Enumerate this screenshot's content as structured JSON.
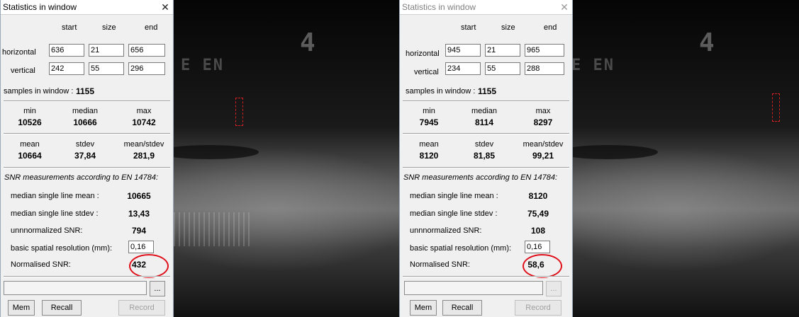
{
  "panels": [
    {
      "title": "Statistics in window",
      "close_glyph": "✕",
      "col_start": "start",
      "col_size": "size",
      "col_end": "end",
      "horizontal_label": "horizontal",
      "vertical_label": "vertical",
      "h_start": "636",
      "h_size": "21",
      "h_end": "656",
      "v_start": "242",
      "v_size": "55",
      "v_end": "296",
      "samples_label": "samples in window :",
      "samples_value": "1155",
      "min_label": "min",
      "median_label": "median",
      "max_label": "max",
      "min": "10526",
      "median": "10666",
      "max": "10742",
      "mean_label": "mean",
      "stdev_label": "stdev",
      "ratio_label": "mean/stdev",
      "mean": "10664",
      "stdev": "37,84",
      "ratio": "281,9",
      "snr_heading": "SNR measurements according to EN 14784:",
      "msl_mean_label": "median single line mean :",
      "msl_mean": "10665",
      "msl_stdev_label": "median single line stdev :",
      "msl_stdev": "13,43",
      "unnorm_label": "unnnormalized SNR:",
      "unnorm": "794",
      "bsr_label": "basic spatial resolution (mm):",
      "bsr": "0,16",
      "norm_label": "Normalised SNR:",
      "norm": "432",
      "browse_label": "...",
      "mem_label": "Mem",
      "recall_label": "Recall",
      "record_label": "Record"
    },
    {
      "title": "Statistics in window",
      "close_glyph": "✕",
      "col_start": "start",
      "col_size": "size",
      "col_end": "end",
      "horizontal_label": "horizontal",
      "vertical_label": "vertical",
      "h_start": "945",
      "h_size": "21",
      "h_end": "965",
      "v_start": "234",
      "v_size": "55",
      "v_end": "288",
      "samples_label": "samples in window :",
      "samples_value": "1155",
      "min_label": "min",
      "median_label": "median",
      "max_label": "max",
      "min": "7945",
      "median": "8114",
      "max": "8297",
      "mean_label": "mean",
      "stdev_label": "stdev",
      "ratio_label": "mean/stdev",
      "mean": "8120",
      "stdev": "81,85",
      "ratio": "99,21",
      "snr_heading": "SNR measurements according to EN 14784:",
      "msl_mean_label": "median single line mean :",
      "msl_mean": "8120",
      "msl_stdev_label": "median single line stdev :",
      "msl_stdev": "75,49",
      "unnorm_label": "unnnormalized SNR:",
      "unnorm": "108",
      "bsr_label": "basic spatial resolution (mm):",
      "bsr": "0,16",
      "norm_label": "Normalised SNR:",
      "norm": "58,6",
      "browse_label": "...",
      "mem_label": "Mem",
      "recall_label": "Recall",
      "record_label": "Record"
    }
  ],
  "image_overlay": {
    "digit": "4",
    "embossed_text": "E EN"
  },
  "colors": {
    "highlight_circle": "#e0101a",
    "roi_marker": "#d02020"
  }
}
